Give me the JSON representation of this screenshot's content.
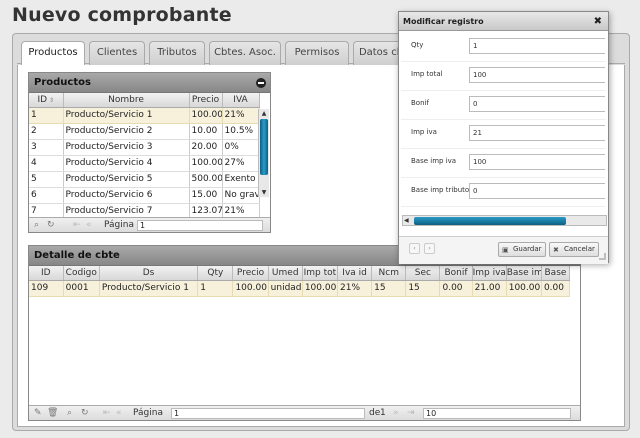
{
  "page": {
    "title": "Nuevo comprobante"
  },
  "tabs": [
    {
      "label": "Productos"
    },
    {
      "label": "Clientes"
    },
    {
      "label": "Tributos"
    },
    {
      "label": "Cbtes. Asoc."
    },
    {
      "label": "Permisos"
    },
    {
      "label": "Datos cb"
    }
  ],
  "productos_grid": {
    "title": "Productos",
    "columns": [
      "ID",
      "Nombre",
      "Precio",
      "IVA"
    ],
    "rows": [
      [
        "1",
        "Producto/Servicio 1",
        "100.00",
        "21%"
      ],
      [
        "2",
        "Producto/Servicio 2",
        "10.00",
        "10.5%"
      ],
      [
        "3",
        "Producto/Servicio 3",
        "20.00",
        "0%"
      ],
      [
        "4",
        "Producto/Servicio 4",
        "100.00",
        "27%"
      ],
      [
        "5",
        "Producto/Servicio 5",
        "500.00",
        "Exento"
      ],
      [
        "6",
        "Producto/Servicio 6",
        "15.00",
        "No grav"
      ],
      [
        "7",
        "Producto/Servicio 7",
        "123.07",
        "21%"
      ]
    ],
    "pager": {
      "page_label": "Página",
      "page_value": "1"
    },
    "icons": [
      "search-icon",
      "refresh-icon",
      "first-page-icon",
      "prev-page-icon",
      "next-page-icon",
      "last-page-icon"
    ]
  },
  "detalle_grid": {
    "title": "Detalle de cbte",
    "columns": [
      "ID",
      "Codigo",
      "Ds",
      "Qty",
      "Precio",
      "Umed",
      "Imp tot",
      "Iva id",
      "Ncm",
      "Sec",
      "Bonif",
      "Imp iva",
      "Base imp",
      "Base"
    ],
    "rows": [
      [
        "109",
        "0001",
        "Producto/Servicio 1",
        "1",
        "100.00",
        "unidad",
        "100.00",
        "21%",
        "15",
        "15",
        "0.00",
        "21.00",
        "100.00",
        "0.00"
      ]
    ],
    "pager": {
      "page_label": "Página",
      "page_value": "1",
      "of_label": "de",
      "total_pages": "1",
      "page_size": "10"
    },
    "icons": [
      "edit-icon",
      "delete-icon",
      "search-icon",
      "refresh-icon"
    ]
  },
  "dialog": {
    "title": "Modificar registro",
    "fields": [
      {
        "label": "Qty",
        "value": "1"
      },
      {
        "label": "Imp total",
        "value": "100"
      },
      {
        "label": "Bonif",
        "value": "0"
      },
      {
        "label": "Imp iva",
        "value": "21"
      },
      {
        "label": "Base imp iva",
        "value": "100"
      },
      {
        "label": "Base imp tributo",
        "value": "0"
      }
    ],
    "save_label": "Guardar",
    "cancel_label": "Cancelar"
  },
  "colors": {
    "accent": "#1d7fa8",
    "header_gray": "#9a9a9a",
    "selected_row": "#f7f1dc"
  }
}
